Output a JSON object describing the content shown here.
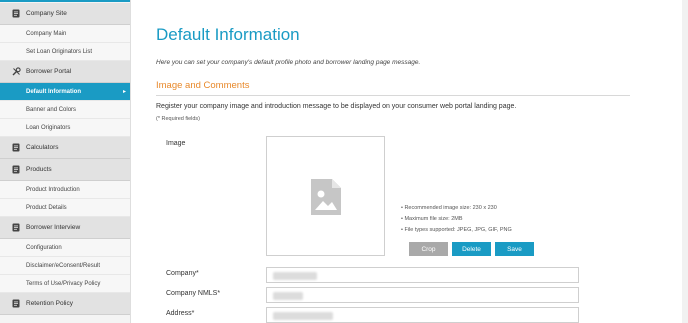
{
  "sidebar": {
    "sections": [
      {
        "label": "Company Site",
        "icon": "document-icon",
        "items": [
          "Company Main",
          "Set Loan Originators List"
        ]
      },
      {
        "label": "Borrower Portal",
        "icon": "tools-icon",
        "items": [
          "Default Information",
          "Banner and Colors",
          "Loan Originators"
        ]
      },
      {
        "label": "Calculators",
        "icon": "document-icon",
        "items": []
      },
      {
        "label": "Products",
        "icon": "document-icon",
        "items": [
          "Product Introduction",
          "Product Details"
        ]
      },
      {
        "label": "Borrower Interview",
        "icon": "document-icon",
        "items": [
          "Configuration",
          "Disclaimer/eConsent/Result",
          "Terms of Use/Privacy Policy"
        ]
      },
      {
        "label": "Retention Policy",
        "icon": "document-icon",
        "items": []
      }
    ],
    "active_item": "Default Information"
  },
  "main": {
    "title": "Default Information",
    "intro": "Here you can set your company's default profile photo and borrower landing page message.",
    "section_title": "Image and Comments",
    "register_text": "Register your company image and introduction message to be displayed on your consumer web portal landing page.",
    "required_note": "(* Required fields)",
    "image_label": "Image",
    "notes": [
      "• Recommended image size: 230 x 230",
      "• Maximum file size: 2MB",
      "• File types supported: JPEG, JPG, GIF, PNG"
    ],
    "buttons": {
      "crop": "Crop",
      "delete": "Delete",
      "save": "Save"
    },
    "fields": [
      {
        "label": "Company*"
      },
      {
        "label": "Company NMLS*"
      },
      {
        "label": "Address*"
      }
    ]
  },
  "colors": {
    "accent": "#1a9bc4",
    "section": "#e8892b",
    "disabled": "#a9a9a9"
  }
}
